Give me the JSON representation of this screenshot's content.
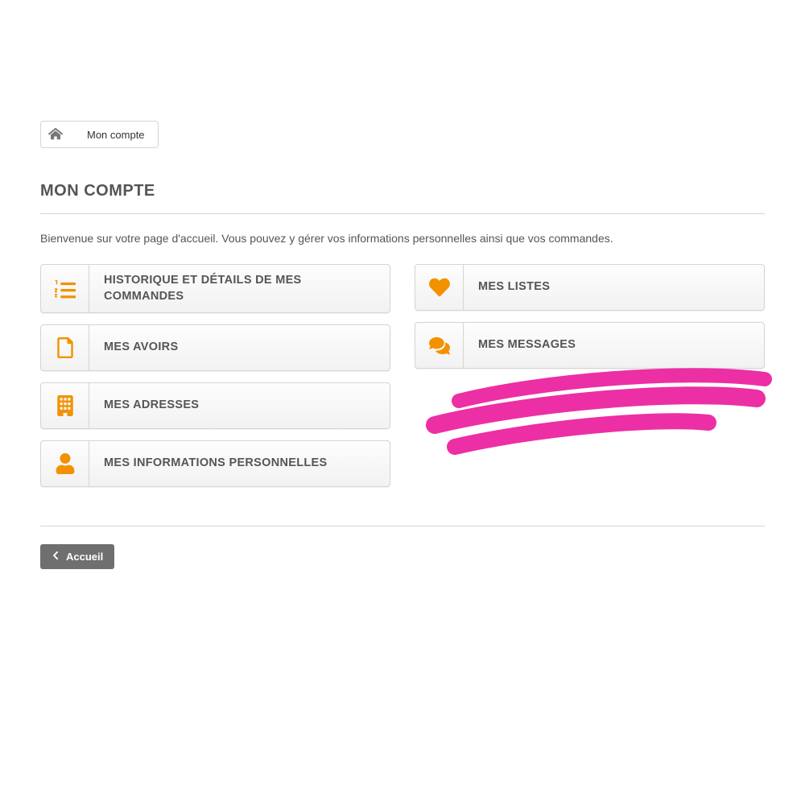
{
  "breadcrumb": {
    "home_icon": "home-icon",
    "current": "Mon compte"
  },
  "title": "MON COMPTE",
  "intro": "Bienvenue sur votre page d'accueil. Vous pouvez y gérer vos informations personnelles ainsi que vos commandes.",
  "tiles_left": [
    {
      "icon": "list-ol-icon",
      "label": "HISTORIQUE ET DÉTAILS DE MES COMMANDES"
    },
    {
      "icon": "file-icon",
      "label": "MES AVOIRS"
    },
    {
      "icon": "building-icon",
      "label": "MES ADRESSES"
    },
    {
      "icon": "user-icon",
      "label": "MES INFORMATIONS PERSONNELLES"
    }
  ],
  "tiles_right": [
    {
      "icon": "heart-icon",
      "label": "MES LISTES"
    },
    {
      "icon": "comments-icon",
      "label": "MES MESSAGES"
    }
  ],
  "back_button": "Accueil",
  "colors": {
    "accent": "#f39200",
    "highlight": "#ec2fa4"
  }
}
